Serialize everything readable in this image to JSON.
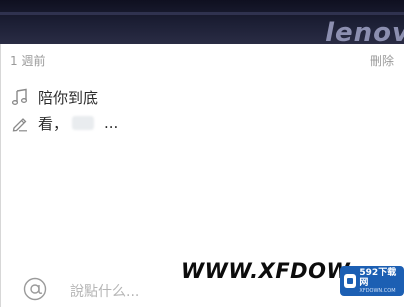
{
  "header": {
    "brand_text": "lenov"
  },
  "meta": {
    "left_text": "1 週前",
    "right_text": "刪除"
  },
  "song": {
    "title": "陪你到底",
    "icon": "music-note-icon"
  },
  "comment": {
    "prefix": "看，",
    "suffix": "...",
    "icon": "pen-icon"
  },
  "reply_bar": {
    "icon": "at-icon",
    "placeholder": "說點什么..."
  },
  "watermark": {
    "text": "WWW.XFDOW",
    "logo_text": "592下载网",
    "logo_sub": "XFDOWN.COM"
  },
  "colors": {
    "banner": "#1d2036",
    "muted_text": "#9a9a9a",
    "logo_blue": "#1c5fb3"
  }
}
